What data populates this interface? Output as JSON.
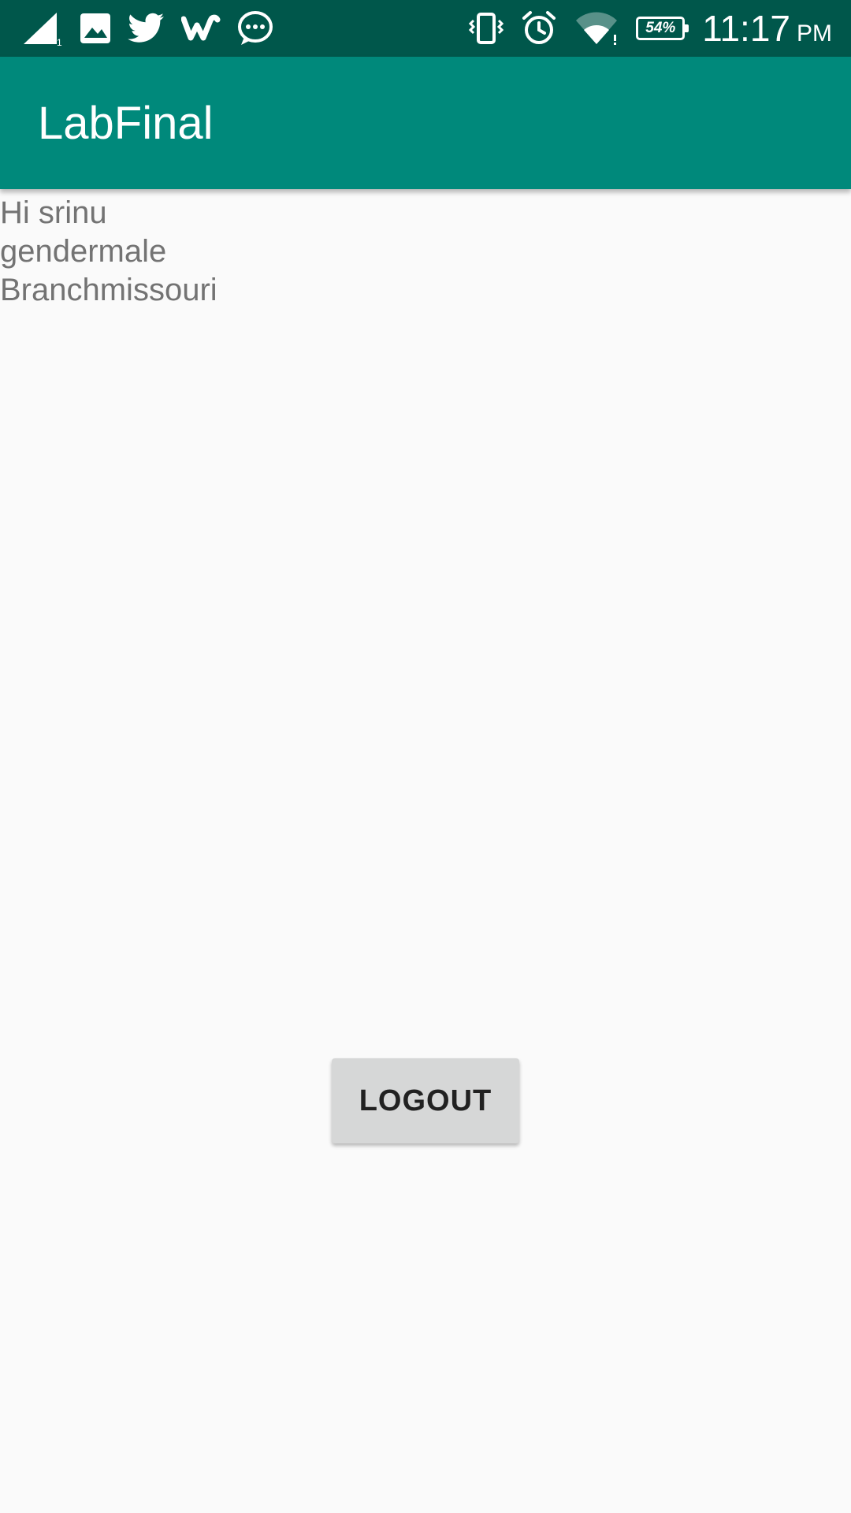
{
  "status_bar": {
    "background": "#00574b",
    "left_icons": [
      "signal-icon",
      "image-icon",
      "twitter-icon",
      "wattpad-icon",
      "message-icon"
    ],
    "right_icons": [
      "vibrate-icon",
      "alarm-icon",
      "wifi-icon",
      "battery-icon"
    ],
    "battery_level": "54%",
    "time": "11:17",
    "ampm": "PM"
  },
  "app_bar": {
    "title": "LabFinal",
    "color": "#00897b"
  },
  "profile": {
    "greeting": "Hi srinu",
    "gender": "gendermale",
    "branch": "Branchmissouri"
  },
  "actions": {
    "logout_label": "LOGOUT"
  }
}
